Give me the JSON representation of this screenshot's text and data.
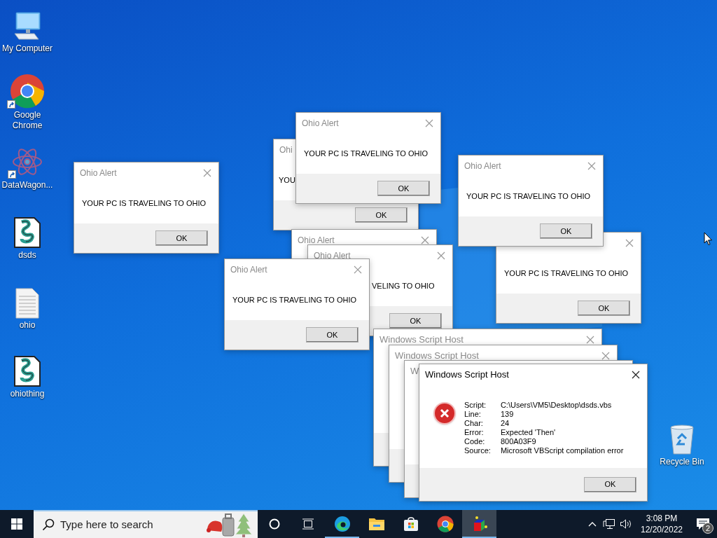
{
  "desktop_icons": [
    {
      "kind": "computer",
      "label": "My Computer",
      "shortcut": false
    },
    {
      "kind": "chrome",
      "label": "Google Chrome",
      "shortcut": true
    },
    {
      "kind": "datawagon",
      "label": "DataWagon...",
      "shortcut": true
    },
    {
      "kind": "script",
      "label": "dsds",
      "shortcut": false
    },
    {
      "kind": "text",
      "label": "ohio",
      "shortcut": false
    },
    {
      "kind": "script",
      "label": "ohiothing",
      "shortcut": false
    },
    {
      "kind": "recycle",
      "label": "Recycle Bin",
      "shortcut": false
    }
  ],
  "windows": [
    {
      "kind": "alert",
      "title": "Ohio Alert",
      "active": false,
      "message": "YOUR PC IS TRAVELING TO OHIO",
      "buttons": [
        "OK"
      ]
    },
    {
      "kind": "alert",
      "title": "Ohi",
      "active": false,
      "message": "YOU",
      "buttons": [
        "OK"
      ]
    },
    {
      "kind": "alert",
      "title": "Ohio Alert",
      "active": false,
      "message": "YOUR PC IS TRAVELING TO OHIO",
      "buttons": [
        "OK"
      ]
    },
    {
      "kind": "alert",
      "active": false,
      "message": "YOUR PC IS TRAVELING TO OHIO",
      "buttons": [
        "OK"
      ]
    },
    {
      "kind": "alert",
      "title": "Ohio Alert",
      "active": false,
      "message": "YOUR PC IS TRAVELING TO OHIO",
      "buttons": [
        "OK"
      ]
    },
    {
      "kind": "alert",
      "title": "Ohio Alert",
      "active": false
    },
    {
      "kind": "alert",
      "title": "Ohio Alert",
      "active": false,
      "message": "VELING TO OHIO",
      "buttons": [
        "OK"
      ]
    },
    {
      "kind": "alert",
      "title": "Ohio Alert",
      "active": false,
      "message": "YOUR PC IS TRAVELING TO OHIO",
      "buttons": [
        "OK"
      ]
    },
    {
      "kind": "error",
      "title": "Windows Script Host",
      "active": false
    },
    {
      "kind": "error",
      "title": "Windows Script Host",
      "active": false
    },
    {
      "kind": "error",
      "title": "W",
      "active": false
    },
    {
      "kind": "error",
      "title": "Windows Script Host",
      "active": true,
      "details": [
        {
          "label": "Script:",
          "value": "C:\\Users\\VM5\\Desktop\\dsds.vbs"
        },
        {
          "label": "Line:",
          "value": "139"
        },
        {
          "label": "Char:",
          "value": "24"
        },
        {
          "label": "Error:",
          "value": "Expected 'Then'"
        },
        {
          "label": "Code:",
          "value": "800A03F9"
        },
        {
          "label": "Source:",
          "value": "Microsoft VBScript compilation error"
        }
      ],
      "buttons": [
        "OK"
      ]
    }
  ],
  "taskbar": {
    "search": {
      "placeholder": "Type here to search"
    },
    "apps": [
      {
        "kind": "edge",
        "running": true,
        "selected": false
      },
      {
        "kind": "explorer",
        "running": false,
        "selected": false
      },
      {
        "kind": "store",
        "running": false,
        "selected": false
      },
      {
        "kind": "chrome",
        "running": false,
        "selected": false
      },
      {
        "kind": "script-app",
        "running": true,
        "selected": true
      }
    ],
    "clock": {
      "time": "3:08 PM",
      "date": "12/20/2022"
    },
    "notifications": {
      "count": "2"
    }
  }
}
